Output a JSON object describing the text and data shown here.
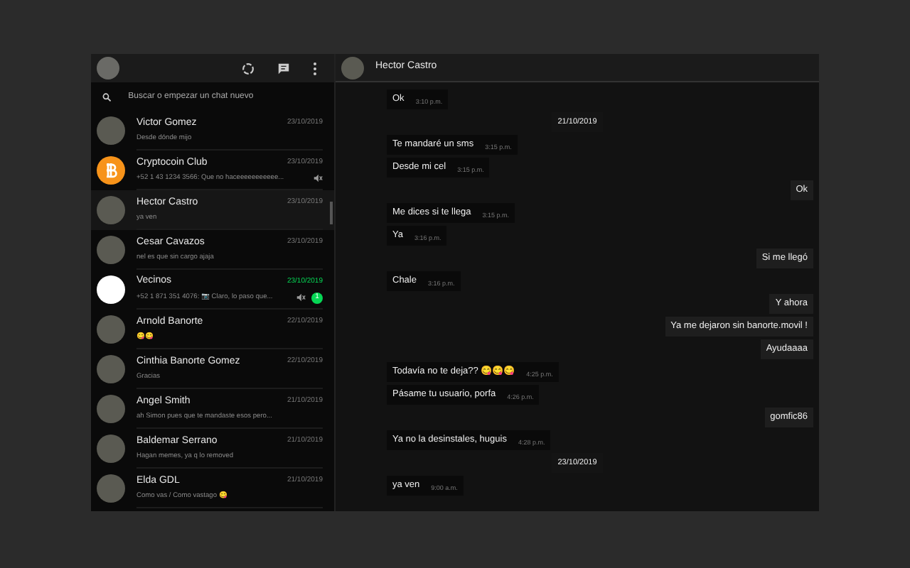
{
  "search": {
    "placeholder": "Buscar o empezar un chat nuevo"
  },
  "chats": [
    {
      "name": "Victor Gomez",
      "date": "23/10/2019",
      "preview": "Desde dónde mijo",
      "muted": false,
      "kind": "photo",
      "selected": false
    },
    {
      "name": "Cryptocoin Club",
      "date": "23/10/2019",
      "preview": "+52 1 43 1234 3566: Que no haceeeeeeeeeee...",
      "muted": true,
      "kind": "bitcoin",
      "selected": false
    },
    {
      "name": "Hector Castro",
      "date": "23/10/2019",
      "preview": "ya ven",
      "muted": false,
      "kind": "photo",
      "selected": true
    },
    {
      "name": "Cesar Cavazos",
      "date": "23/10/2019",
      "preview": "nel es que sin cargo ajaja",
      "muted": false,
      "kind": "photo",
      "selected": false
    },
    {
      "name": "Vecinos",
      "date": "23/10/2019",
      "preview": "+52 1 871 351 4076: 📷 Claro, lo paso que...",
      "muted": true,
      "unread": "1",
      "kind": "blank",
      "selected": false
    },
    {
      "name": "Arnold Banorte",
      "date": "22/10/2019",
      "preview": "😋😋",
      "muted": false,
      "kind": "photo",
      "selected": false
    },
    {
      "name": "Cinthia Banorte Gomez",
      "date": "22/10/2019",
      "preview": "Gracias",
      "muted": false,
      "kind": "photo",
      "selected": false
    },
    {
      "name": "Angel Smith",
      "date": "21/10/2019",
      "preview": "ah Simon pues que te mandaste esos pero...",
      "muted": false,
      "kind": "photo",
      "selected": false
    },
    {
      "name": "Baldemar Serrano",
      "date": "21/10/2019",
      "preview": "Hagan memes, ya q lo removed",
      "muted": false,
      "kind": "photo",
      "selected": false
    },
    {
      "name": "Elda GDL",
      "date": "21/10/2019",
      "preview": "Como vas / Como vastago 😋",
      "muted": false,
      "kind": "photo",
      "selected": false
    }
  ],
  "conversation": {
    "title": "Hector Castro",
    "messages": [
      {
        "kind": "in",
        "text": "Ok",
        "time": "3:10 p.m."
      },
      {
        "kind": "date",
        "text": "21/10/2019"
      },
      {
        "kind": "in",
        "text": "Te mandaré un sms",
        "time": "3:15 p.m."
      },
      {
        "kind": "in",
        "text": "Desde mi cel",
        "time": "3:15 p.m."
      },
      {
        "kind": "out",
        "text": "Ok"
      },
      {
        "kind": "in",
        "text": "Me dices si te llega",
        "time": "3:15 p.m."
      },
      {
        "kind": "in",
        "text": "Ya",
        "time": "3:16 p.m."
      },
      {
        "kind": "out",
        "text": "Si me llegó"
      },
      {
        "kind": "in",
        "text": "Chale",
        "time": "3:16 p.m."
      },
      {
        "kind": "out",
        "text": "Y ahora"
      },
      {
        "kind": "out",
        "text": "Ya me dejaron sin banorte.movil !"
      },
      {
        "kind": "out",
        "text": "Ayudaaaa"
      },
      {
        "kind": "in",
        "text": "Todavía no te deja?? 😋😋😋",
        "time": "4:25 p.m."
      },
      {
        "kind": "in",
        "text": "Pásame tu usuario, porfa",
        "time": "4:26 p.m."
      },
      {
        "kind": "out",
        "text": "gomfic86"
      },
      {
        "kind": "in",
        "text": "Ya no la desinstales, huguis",
        "time": "4:28 p.m."
      },
      {
        "kind": "date",
        "text": "23/10/2019"
      },
      {
        "kind": "in",
        "text": "ya ven",
        "time": "9:00 a.m."
      }
    ]
  }
}
